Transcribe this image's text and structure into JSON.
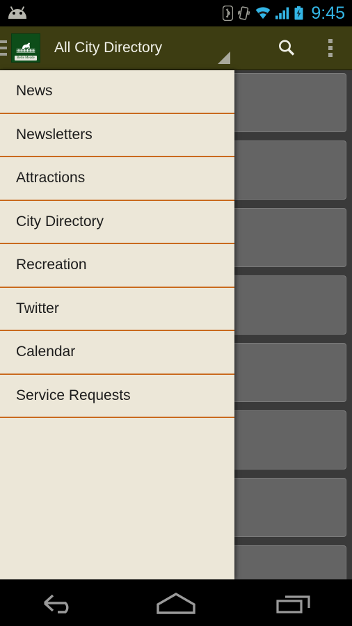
{
  "status_bar": {
    "time": "9:45",
    "icons": [
      {
        "name": "android-debug-icon",
        "glyph": "android"
      },
      {
        "name": "bluetooth-icon",
        "glyph": "bluetooth"
      },
      {
        "name": "vibrate-mode-icon",
        "glyph": "vibrate"
      },
      {
        "name": "wifi-icon",
        "glyph": "wifi"
      },
      {
        "name": "cellular-signal-icon",
        "glyph": "signal"
      },
      {
        "name": "battery-charging-icon",
        "glyph": "battery-charging"
      }
    ]
  },
  "action_bar": {
    "title": "All City Directory",
    "logo_alt": "Belle Meade",
    "logo_caption": "Belle Meade",
    "menu_icon": "hamburger-icon",
    "search_icon": "search-icon",
    "overflow_icon": "overflow-menu-icon",
    "bar_color": "#3d3d12"
  },
  "drawer": {
    "background_color": "#ece7d8",
    "divider_color": "#c96a1e",
    "items": [
      {
        "label": "News"
      },
      {
        "label": "Newsletters"
      },
      {
        "label": "Attractions"
      },
      {
        "label": "City Directory"
      },
      {
        "label": "Recreation"
      },
      {
        "label": "Twitter"
      },
      {
        "label": "Calendar"
      },
      {
        "label": "Service Requests"
      }
    ]
  },
  "content": {
    "background_color": "#3a3a3a",
    "card_color": "#646464",
    "placeholder_cards": 8
  },
  "nav_bar": {
    "buttons": [
      {
        "name": "back-button",
        "icon": "back-arrow-icon"
      },
      {
        "name": "home-button",
        "icon": "home-icon"
      },
      {
        "name": "recents-button",
        "icon": "recent-apps-icon"
      }
    ]
  }
}
